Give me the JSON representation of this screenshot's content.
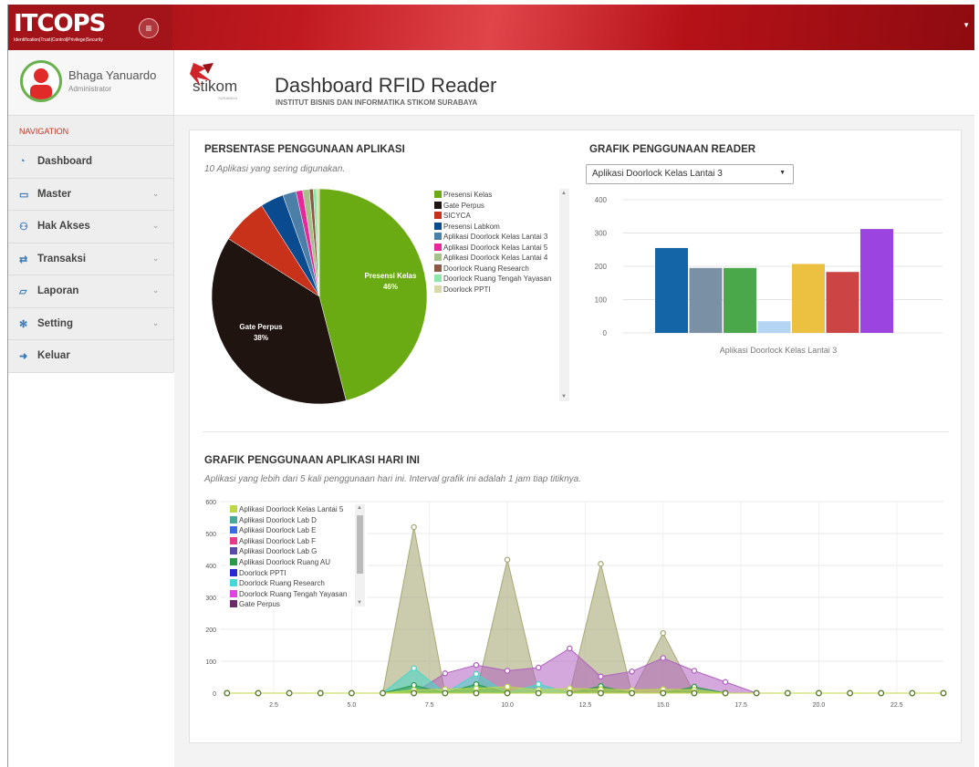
{
  "brand": {
    "logo_text": "ITCOPS",
    "logo_tagline": "Identification|Trust|Control|Privilege|Security"
  },
  "user": {
    "name": "Bhaga Yanuardo",
    "role": "Administrator"
  },
  "nav": {
    "heading": "NAVIGATION",
    "items": [
      {
        "label": "Dashboard",
        "icon": "dashboard-icon",
        "has_children": false
      },
      {
        "label": "Master",
        "icon": "laptop-icon",
        "has_children": true
      },
      {
        "label": "Hak Akses",
        "icon": "users-icon",
        "has_children": true
      },
      {
        "label": "Transaksi",
        "icon": "exchange-icon",
        "has_children": true
      },
      {
        "label": "Laporan",
        "icon": "folder-icon",
        "has_children": true
      },
      {
        "label": "Setting",
        "icon": "gear-icon",
        "has_children": true
      },
      {
        "label": "Keluar",
        "icon": "sign-out-icon",
        "has_children": false
      }
    ]
  },
  "header": {
    "logo_text": "stikom",
    "logo_small": "SURABAYA",
    "title": "Dashboard RFID Reader",
    "subtitle": "INSTITUT BISNIS DAN INFORMATIKA STIKOM SURABAYA"
  },
  "pie_section": {
    "title": "PERSENTASE PENGGUNAAN APLIKASI",
    "subtitle": "10 Aplikasi yang sering digunakan."
  },
  "bar_section": {
    "title": "GRAFIK PENGGUNAAN READER",
    "selected": "Aplikasi Doorlock Kelas Lantai 3"
  },
  "line_section": {
    "title": "GRAFIK PENGGUNAAN APLIKASI HARI INI",
    "subtitle": "Aplikasi yang lebih dari 5 kali penggunaan hari ini. Interval grafik ini adalah 1 jam tiap titiknya."
  },
  "chart_data": [
    {
      "type": "pie",
      "labels": [
        "Presensi Kelas",
        "Gate Perpus",
        "SICYCA",
        "Presensi Labkom",
        "Aplikasi Doorlock Kelas Lantai 3",
        "Aplikasi Doorlock Kelas Lantai 5",
        "Aplikasi Doorlock Kelas Lantai 4",
        "Doorlock Ruang Research",
        "Doorlock Ruang Tengah Yayasan",
        "Doorlock PPTI"
      ],
      "values": [
        46,
        38,
        7,
        3.5,
        2,
        1,
        1,
        0.6,
        0.5,
        0.4
      ],
      "colors": [
        "#6aaa13",
        "#1f1410",
        "#c8321a",
        "#0a4a8f",
        "#4b7fa8",
        "#e8279b",
        "#a6c28a",
        "#8a5a44",
        "#8ee6a8",
        "#d8d8a8"
      ],
      "slice_labels": [
        {
          "name": "Presensi Kelas",
          "percent": "46%"
        },
        {
          "name": "Gate Perpus",
          "percent": "38%"
        }
      ]
    },
    {
      "type": "bar",
      "categories": [
        "Aplikasi Doorlock Kelas Lantai 3"
      ],
      "values": [
        255,
        195,
        195,
        35,
        207,
        183,
        312
      ],
      "colors": [
        "#1464a8",
        "#7a90a4",
        "#4aa84a",
        "#b4d4f4",
        "#ecc040",
        "#cc4444",
        "#9b44e0"
      ],
      "ylim": [
        0,
        400
      ],
      "yticks": [
        "0",
        "100",
        "200",
        "300",
        "400"
      ],
      "xlabel": "Aplikasi Doorlock Kelas Lantai 3"
    },
    {
      "type": "area",
      "x": [
        1,
        2,
        3,
        4,
        5,
        6,
        7,
        8,
        9,
        10,
        11,
        12,
        13,
        14,
        15,
        16,
        17,
        18,
        19,
        20,
        21,
        22,
        23,
        24
      ],
      "xlim": [
        0.8,
        24
      ],
      "ylim": [
        0,
        600
      ],
      "xticks": [
        "2.5",
        "5.0",
        "7.5",
        "10.0",
        "12.5",
        "15.0",
        "17.5",
        "20.0",
        "22.5"
      ],
      "xtick_values": [
        2.5,
        5,
        7.5,
        10,
        12.5,
        15,
        17.5,
        20,
        22.5
      ],
      "yticks": [
        "0",
        "100",
        "200",
        "300",
        "400",
        "500",
        "600"
      ],
      "legend": [
        "Aplikasi Doorlock Kelas Lantai 5",
        "Aplikasi Doorlock Lab D",
        "Aplikasi Doorlock Lab E",
        "Aplikasi Doorlock Lab F",
        "Aplikasi Doorlock Lab G",
        "Aplikasi Doorlock Ruang AU",
        "Doorlock PPTI",
        "Doorlock Ruang Research",
        "Doorlock Ruang Tengah Yayasan",
        "Gate Perpus"
      ],
      "legend_colors": [
        "#bcd84a",
        "#4aa898",
        "#3a6ae0",
        "#e83a8a",
        "#5a4aa8",
        "#2a9a4a",
        "#2a2ad0",
        "#44d8d8",
        "#e044e0",
        "#6a2a6a"
      ],
      "series": [
        {
          "color": "#a8a878",
          "values": [
            0,
            0,
            0,
            0,
            0,
            0,
            520,
            0,
            0,
            418,
            0,
            0,
            405,
            0,
            188,
            0,
            0,
            0,
            0,
            0,
            0,
            0,
            0,
            0
          ]
        },
        {
          "color": "#b060c0",
          "values": [
            0,
            0,
            0,
            0,
            0,
            0,
            0,
            62,
            88,
            70,
            80,
            140,
            52,
            68,
            110,
            70,
            35,
            0,
            0,
            0,
            0,
            0,
            0,
            0
          ]
        },
        {
          "color": "#44d8c8",
          "values": [
            0,
            0,
            0,
            0,
            0,
            0,
            78,
            0,
            60,
            0,
            28,
            0,
            0,
            0,
            0,
            0,
            0,
            0,
            0,
            0,
            0,
            0,
            0,
            0
          ]
        },
        {
          "color": "#2a9a4a",
          "values": [
            0,
            0,
            0,
            0,
            0,
            0,
            25,
            0,
            28,
            0,
            0,
            0,
            22,
            0,
            0,
            20,
            0,
            0,
            0,
            0,
            0,
            0,
            0,
            0
          ]
        },
        {
          "color": "#bcd84a",
          "values": [
            0,
            0,
            0,
            0,
            0,
            0,
            10,
            12,
            15,
            20,
            10,
            15,
            12,
            10,
            12,
            10,
            0,
            0,
            0,
            0,
            0,
            0,
            0,
            0
          ]
        }
      ]
    }
  ]
}
